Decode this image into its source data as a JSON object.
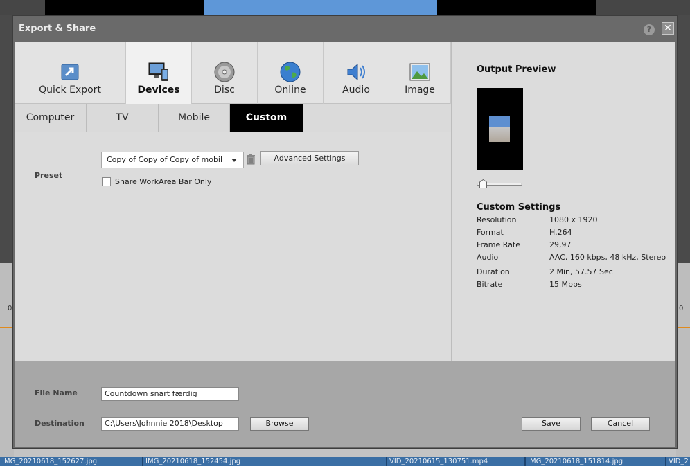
{
  "dialog": {
    "title": "Export & Share",
    "help_label": "?",
    "close_label": "✕"
  },
  "main_tabs": [
    {
      "label": "Quick Export",
      "icon": "quick-export-icon"
    },
    {
      "label": "Devices",
      "icon": "devices-icon",
      "active": true
    },
    {
      "label": "Disc",
      "icon": "disc-icon"
    },
    {
      "label": "Online",
      "icon": "globe-icon"
    },
    {
      "label": "Audio",
      "icon": "speaker-icon"
    },
    {
      "label": "Image",
      "icon": "image-icon"
    }
  ],
  "sub_tabs": [
    {
      "label": "Computer"
    },
    {
      "label": "TV"
    },
    {
      "label": "Mobile"
    },
    {
      "label": "Custom",
      "active": true
    }
  ],
  "preset": {
    "label": "Preset",
    "value": "Copy of Copy of Copy of mobil",
    "advanced_label": "Advanced Settings",
    "share_workarea_label": "Share WorkArea Bar Only",
    "share_workarea_checked": false
  },
  "output_preview": {
    "title": "Output Preview"
  },
  "custom_settings": {
    "title": "Custom Settings",
    "rows": [
      {
        "key": "Resolution",
        "value": "1080 x 1920"
      },
      {
        "key": "Format",
        "value": "H.264"
      },
      {
        "key": "Frame Rate",
        "value": "29,97"
      },
      {
        "key": "Audio",
        "value": "AAC, 160 kbps, 48 kHz, Stereo"
      },
      {
        "key": "Duration",
        "value": "2 Min, 57.57 Sec"
      },
      {
        "key": "Bitrate",
        "value": "15 Mbps"
      }
    ]
  },
  "file": {
    "name_label": "File Name",
    "name_value": "Countdown snart færdig",
    "dest_label": "Destination",
    "dest_value": "C:\\Users\\Johnnie 2018\\Desktop",
    "browse_label": "Browse",
    "save_label": "Save",
    "cancel_label": "Cancel"
  },
  "background": {
    "tick_left": "0",
    "tick_right": "0",
    "clips": [
      "IMG_20210618_152627.jpg",
      "IMG_20210618_152454.jpg",
      "VID_20210615_130751.mp4",
      "IMG_20210618_151814.jpg",
      "VID_2"
    ]
  }
}
